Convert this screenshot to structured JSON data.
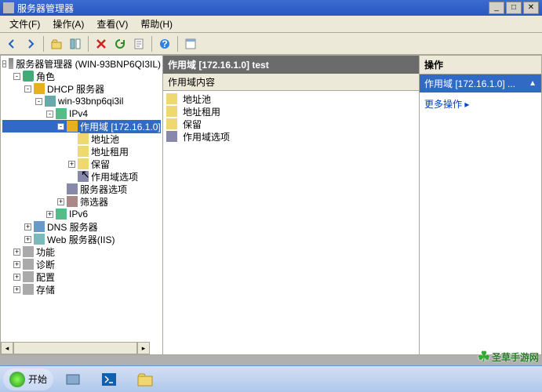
{
  "window": {
    "title": "服务器管理器"
  },
  "menu": {
    "file": "文件(F)",
    "action": "操作(A)",
    "view": "查看(V)",
    "help": "帮助(H)"
  },
  "winbtns": {
    "min": "_",
    "max": "□",
    "close": "✕"
  },
  "tree": {
    "root": "服务器管理器 (WIN-93BNP6QI3IL)",
    "roles": "角色",
    "dhcp": "DHCP 服务器",
    "host": "win-93bnp6qi3il",
    "ipv4": "IPv4",
    "scope": "作用域 [172.16.1.0]",
    "pool": "地址池",
    "lease": "地址租用",
    "reserve": "保留",
    "scopeopt": "作用域选项",
    "serveropt": "服务器选项",
    "filter": "筛选器",
    "ipv6": "IPv6",
    "dns": "DNS 服务器",
    "web": "Web 服务器(IIS)",
    "features": "功能",
    "diag": "诊断",
    "config": "配置",
    "storage": "存储"
  },
  "mid": {
    "title": "作用域 [172.16.1.0] test",
    "colhead": "作用域内容",
    "items": [
      {
        "label": "地址池"
      },
      {
        "label": "地址租用"
      },
      {
        "label": "保留"
      },
      {
        "label": "作用域选项"
      }
    ]
  },
  "right": {
    "title": "操作",
    "subtitle": "作用域 [172.16.1.0] ...",
    "more": "更多操作"
  },
  "taskbar": {
    "start": "开始"
  },
  "watermark": "圣草手游网"
}
